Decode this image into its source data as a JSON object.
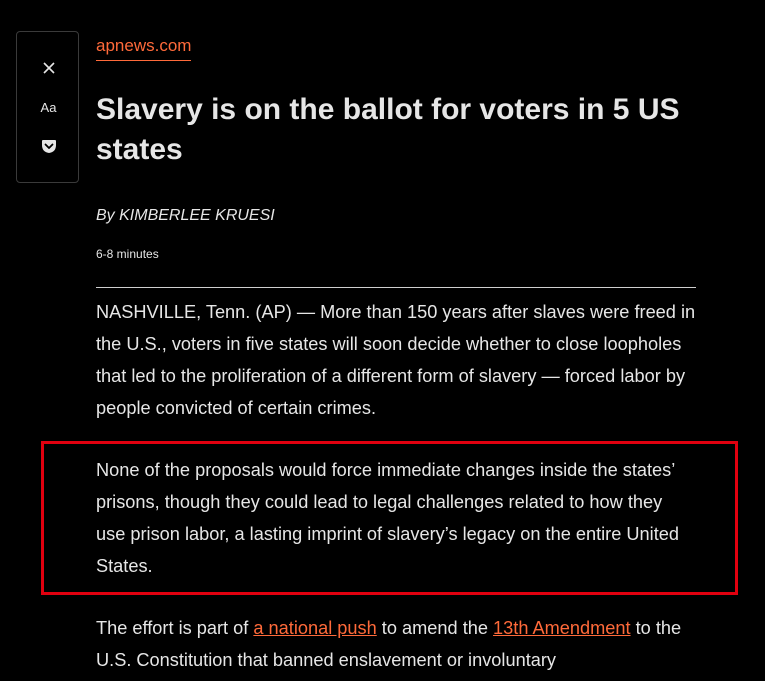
{
  "toolbar": {
    "close_glyph": "✕",
    "type_label": "Aa",
    "icons": [
      "close-icon",
      "type-settings-icon",
      "pocket-icon"
    ]
  },
  "article": {
    "domain": "apnews.com",
    "title": "Slavery is on the ballot for voters in 5 US states",
    "byline": "By KIMBERLEE KRUESI",
    "reading_time": "6-8 minutes",
    "paragraphs": {
      "p1": "NASHVILLE, Tenn. (AP) — More than 150 years after slaves were freed in the U.S., voters in five states will soon decide whether to close loopholes that led to the proliferation of a different form of slavery — forced labor by people convicted of certain crimes.",
      "p2": "None of the proposals would force immediate changes inside the states’ prisons, though they could lead to legal challenges related to how they use prison labor, a lasting imprint of slavery’s legacy on the entire United States.",
      "p3": {
        "text_1": "The effort is part of ",
        "link_1": "a national push",
        "text_2": " to amend the ",
        "link_2": "13th Amendment",
        "text_3": " to the U.S. Constitution that banned enslavement or involuntary"
      }
    }
  },
  "colors": {
    "background": "#000000",
    "text": "#e6e6e6",
    "link": "#ff6a3a",
    "highlight_border": "#e0000f"
  }
}
